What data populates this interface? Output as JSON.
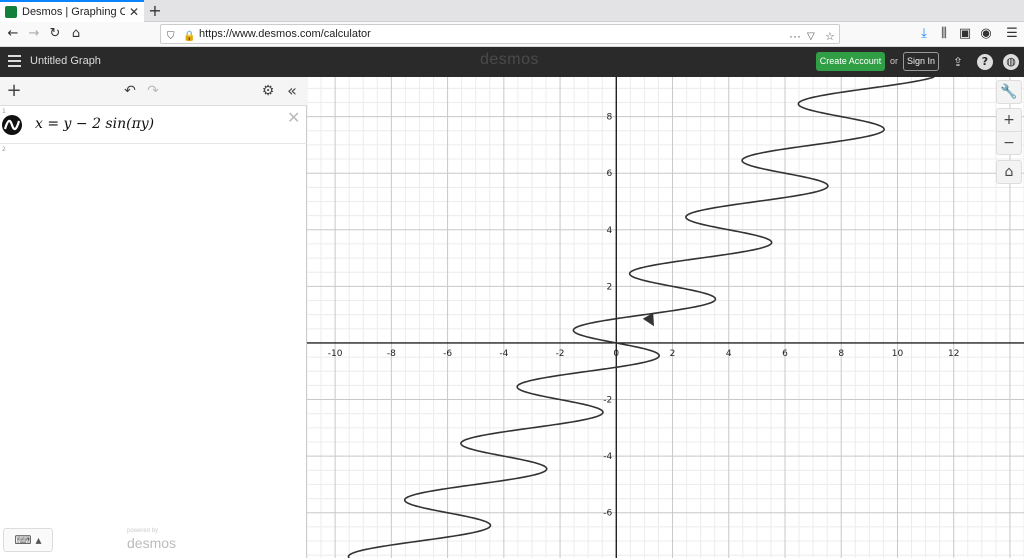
{
  "browser": {
    "tab_title": "Desmos | Graphing Calculat",
    "url": "https://www.desmos.com/calculator"
  },
  "header": {
    "graph_title": "Untitled Graph",
    "logo": "desmos",
    "create_account": "Create Account",
    "or": "or",
    "sign_in": "Sign In"
  },
  "expressions": [
    {
      "index": "1",
      "latex_display": "x = y − 2 sin(πy)"
    },
    {
      "index": "2",
      "latex_display": ""
    }
  ],
  "footer": {
    "powered_by": "powered by",
    "brand": "desmos"
  },
  "chart_data": {
    "type": "line",
    "equation": "x = y - 2 sin(pi y)",
    "xlim": [
      -11,
      14.5
    ],
    "ylim": [
      -7.6,
      9.4
    ],
    "x_ticks": [
      -10,
      -8,
      -6,
      -4,
      -2,
      0,
      2,
      4,
      6,
      8,
      10,
      12
    ],
    "y_ticks": [
      -6,
      -4,
      -2,
      2,
      4,
      6,
      8
    ],
    "grid": true,
    "color": "#333333"
  }
}
